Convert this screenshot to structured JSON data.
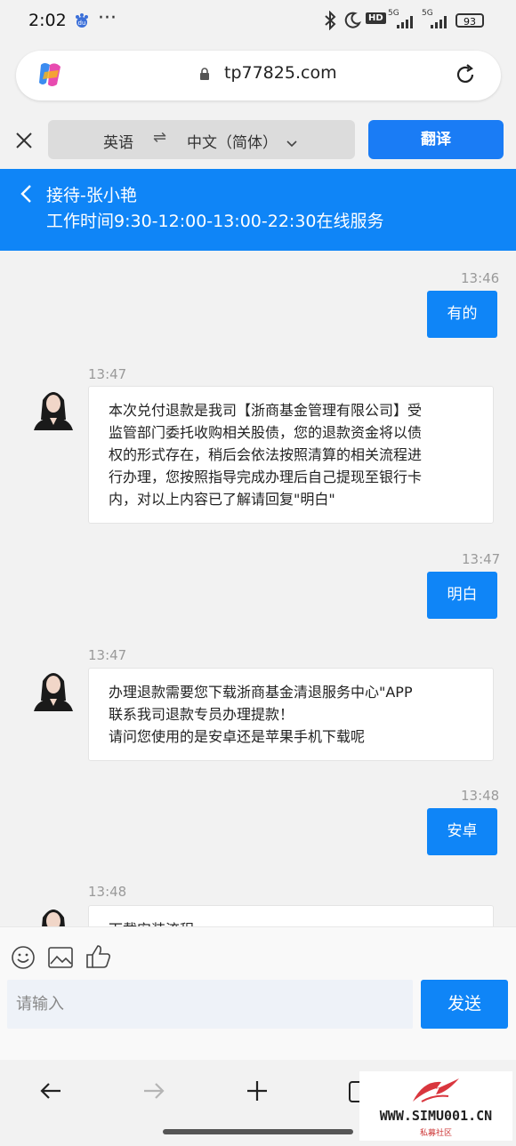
{
  "status_bar": {
    "time": "2:02",
    "battery": "93",
    "net1": "5G",
    "net2": "5G",
    "hd": "HD"
  },
  "browser": {
    "url": "tp77825.com"
  },
  "translate_bar": {
    "source_lang": "英语",
    "swap_symbol": "⇌",
    "target_lang": "中文（简体）",
    "translate_button": "翻译"
  },
  "chat_header": {
    "title": "接待-张小艳",
    "subtitle": "工作时间9:30-12:00-13:00-22:30在线服务"
  },
  "messages": [
    {
      "sender": "user",
      "time": "13:46",
      "text": "有的"
    },
    {
      "sender": "agent",
      "time": "13:47",
      "lines": [
        "本次兑付退款是我司【浙商基金管理有限公司】受",
        "监管部门委托收购相关股债，您的退款资金将以债",
        "权的形式存在，稍后会依法按照清算的相关流程进",
        "行办理，您按照指导完成办理后自己提现至银行卡",
        "内，对以上内容已了解请回复\"明白\""
      ]
    },
    {
      "sender": "user",
      "time": "13:47",
      "text": "明白"
    },
    {
      "sender": "agent",
      "time": "13:47",
      "lines": [
        "办理退款需要您下载浙商基金清退服务中心\"APP",
        "联系我司退款专员办理提款！",
        "请问您使用的是安卓还是苹果手机下载呢"
      ]
    },
    {
      "sender": "user",
      "time": "13:48",
      "text": "安卓"
    },
    {
      "sender": "agent",
      "time": "13:48",
      "lines": [
        "下载安装流程"
      ]
    }
  ],
  "input": {
    "placeholder": "请输入",
    "send_label": "发送"
  },
  "watermark": {
    "site": "WWW.SIMU001.CN",
    "name": "私募社区"
  },
  "colors": {
    "accent": "#0f85f7",
    "translate_button": "#1a7cf5"
  }
}
